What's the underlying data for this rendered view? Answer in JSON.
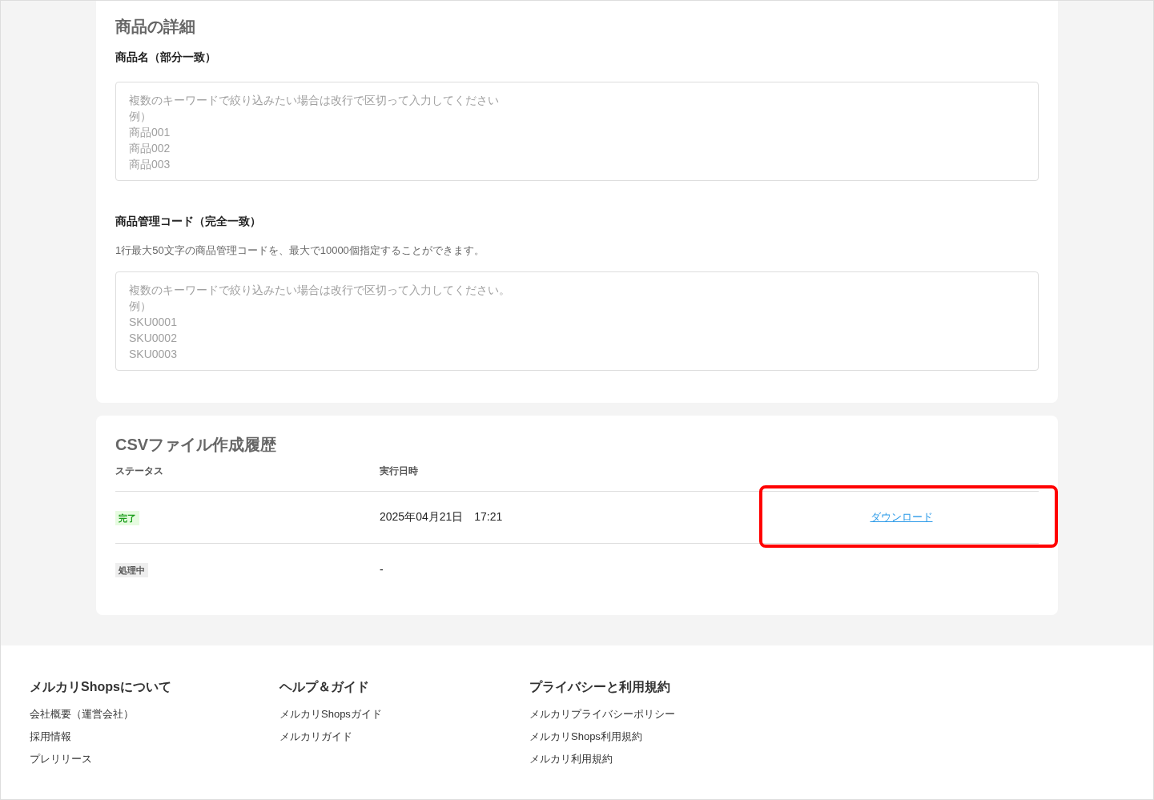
{
  "product_details": {
    "title": "商品の詳細",
    "name_field": {
      "label": "商品名（部分一致）",
      "placeholder": [
        "複数のキーワードで絞り込みたい場合は改行で区切って入力してください",
        "例）",
        "商品001",
        "商品002",
        "商品003"
      ]
    },
    "code_field": {
      "label": "商品管理コード（完全一致）",
      "help": "1行最大50文字の商品管理コードを、最大で10000個指定することができます。",
      "placeholder": [
        "複数のキーワードで絞り込みたい場合は改行で区切って入力してください。",
        "例）",
        "SKU0001",
        "SKU0002",
        "SKU0003"
      ]
    }
  },
  "csv_history": {
    "title": "CSVファイル作成履歴",
    "columns": [
      "ステータス",
      "実行日時"
    ],
    "rows": [
      {
        "status": "完了",
        "kind": "done",
        "executed_at": "2025年04月21日　17:21",
        "action": "ダウンロード",
        "highlighted": true
      },
      {
        "status": "処理中",
        "kind": "processing",
        "executed_at": "-"
      }
    ]
  },
  "footer": {
    "columns": [
      {
        "title": "メルカリShopsについて",
        "links": [
          "会社概要（運営会社）",
          "採用情報",
          "プレリリース"
        ]
      },
      {
        "title": "ヘルプ＆ガイド",
        "links": [
          "メルカリShopsガイド",
          "メルカリガイド"
        ]
      },
      {
        "title": "プライバシーと利用規約",
        "links": [
          "メルカリプライバシーポリシー",
          "メルカリShops利用規約",
          "メルカリ利用規約"
        ]
      }
    ]
  }
}
